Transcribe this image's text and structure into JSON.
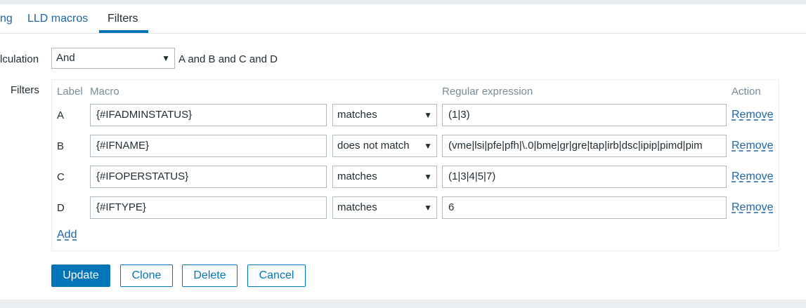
{
  "tabs": [
    {
      "label": "ng"
    },
    {
      "label": "LLD macros"
    },
    {
      "label": "Filters"
    }
  ],
  "calculation": {
    "label": "lculation",
    "selected": "And",
    "formula": "A and B and C and D"
  },
  "filters": {
    "label": "Filters",
    "headers": {
      "label": "Label",
      "macro": "Macro",
      "regex": "Regular expression",
      "action": "Action"
    },
    "rows": [
      {
        "label": "A",
        "macro": "{#IFADMINSTATUS}",
        "operator": "matches",
        "regex": "(1|3)",
        "action": "Remove"
      },
      {
        "label": "B",
        "macro": "{#IFNAME}",
        "operator": "does not match",
        "regex": "(vme|lsi|pfe|pfh|\\.0|bme|gr|gre|tap|irb|dsc|ipip|pimd|pim",
        "action": "Remove"
      },
      {
        "label": "C",
        "macro": "{#IFOPERSTATUS}",
        "operator": "matches",
        "regex": "(1|3|4|5|7)",
        "action": "Remove"
      },
      {
        "label": "D",
        "macro": "{#IFTYPE}",
        "operator": "matches",
        "regex": "6",
        "action": "Remove"
      }
    ],
    "add_label": "Add"
  },
  "buttons": {
    "update": "Update",
    "clone": "Clone",
    "delete": "Delete",
    "cancel": "Cancel"
  },
  "icons": {
    "dropdown": "dropdown-arrow-icon",
    "arrow_glyph": "▼"
  },
  "colors": {
    "accent": "#0275b8",
    "link": "#1f65a6",
    "text": "#1f2c33",
    "muted": "#768d99",
    "border": "#acbbc2",
    "background": "#ebeef0"
  }
}
